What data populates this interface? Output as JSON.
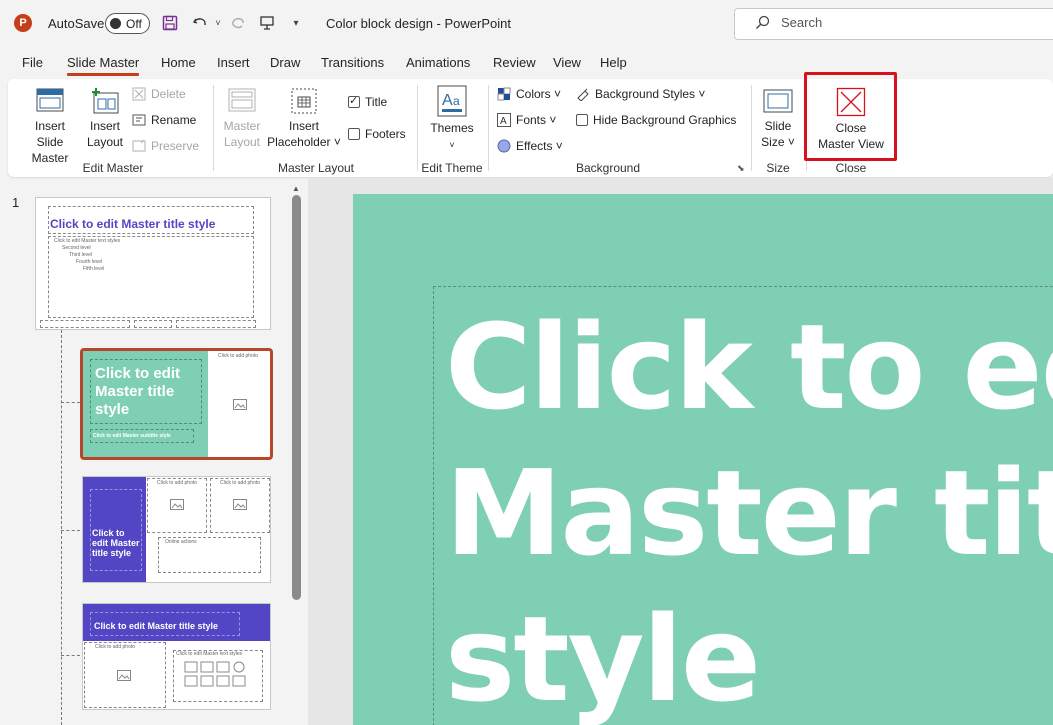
{
  "titlebar": {
    "app_logo": "P",
    "autosave_label": "AutoSave",
    "autosave_state": "Off",
    "doc_title": "Color block design  -  PowerPoint",
    "search_placeholder": "Search"
  },
  "tabs": [
    "File",
    "Slide Master",
    "Home",
    "Insert",
    "Draw",
    "Transitions",
    "Animations",
    "Review",
    "View",
    "Help"
  ],
  "active_tab": "Slide Master",
  "ribbon": {
    "edit_master": {
      "label": "Edit Master",
      "insert_slide_master": [
        "Insert Slide",
        "Master"
      ],
      "insert_layout": [
        "Insert",
        "Layout"
      ],
      "delete": "Delete",
      "rename": "Rename",
      "preserve": "Preserve"
    },
    "master_layout": {
      "label": "Master Layout",
      "master_layout_btn": [
        "Master",
        "Layout"
      ],
      "insert_placeholder": [
        "Insert",
        "Placeholder ˅"
      ],
      "title_checkbox": "Title",
      "footers_checkbox": "Footers"
    },
    "edit_theme": {
      "label": "Edit Theme",
      "themes": "Themes"
    },
    "background": {
      "label": "Background",
      "colors": "Colors ˅",
      "fonts": "Fonts ˅",
      "effects": "Effects ˅",
      "background_styles": "Background Styles ˅",
      "hide_background_graphics": "Hide Background Graphics"
    },
    "size": {
      "label": "Size",
      "slide_size": [
        "Slide",
        "Size ˅"
      ]
    },
    "close": {
      "label": "Close",
      "close_master_view": [
        "Close",
        "Master View"
      ]
    }
  },
  "thumbnails": {
    "slide_number": "1",
    "master": {
      "title": "Click to edit Master title style",
      "text_levels": [
        "Click to edit Master text styles",
        "Second level",
        "Third level",
        "Fourth level",
        "Fifth level"
      ]
    },
    "layout1": {
      "title": "Click to edit Master title style",
      "subtitle": "Click to edit Master subtitle style",
      "photo": "Click to add photo"
    },
    "layout2": {
      "title": "Click to edit Master title style",
      "photo": "Click to add photo",
      "text": "Online actions"
    },
    "layout3": {
      "title": "Click to edit Master title style",
      "photo": "Click to add photo",
      "text": "Click to edit Master text styles"
    }
  },
  "slide": {
    "title": "Click to edit Master title style",
    "background_color": "#7fcfb4"
  },
  "colors": {
    "accent": "#c43e1c",
    "highlight": "#d6121d",
    "purple": "#5346c4",
    "teal": "#7fcfb4"
  }
}
